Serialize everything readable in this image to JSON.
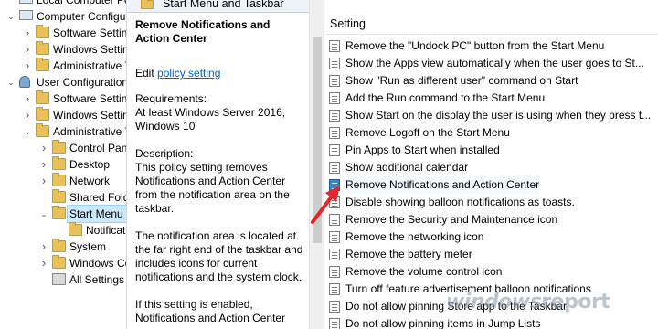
{
  "tree": {
    "items": [
      {
        "label": "Local Computer Policy",
        "expand": "",
        "icon": "computer-icon"
      },
      {
        "label": "Computer Configura",
        "expand": "open",
        "icon": "computer-icon"
      },
      {
        "label": "Software Settings",
        "expand": "closed",
        "icon": "folder-icon"
      },
      {
        "label": "Windows Setting",
        "expand": "closed",
        "icon": "folder-icon"
      },
      {
        "label": "Administrative Te",
        "expand": "closed",
        "icon": "folder-icon"
      },
      {
        "label": "User Configuration",
        "expand": "open",
        "icon": "user-icon"
      },
      {
        "label": "Software Settings",
        "expand": "closed",
        "icon": "folder-icon"
      },
      {
        "label": "Windows Setting",
        "expand": "closed",
        "icon": "folder-icon"
      },
      {
        "label": "Administrative Te",
        "expand": "open",
        "icon": "folder-icon"
      },
      {
        "label": "Control Panel",
        "expand": "closed",
        "icon": "folder-icon"
      },
      {
        "label": "Desktop",
        "expand": "closed",
        "icon": "folder-icon"
      },
      {
        "label": "Network",
        "expand": "closed",
        "icon": "folder-icon"
      },
      {
        "label": "Shared Folder",
        "expand": "",
        "icon": "folder-icon"
      },
      {
        "label": "Start Menu ar",
        "expand": "open",
        "icon": "folder-icon"
      },
      {
        "label": "Notificatio",
        "expand": "",
        "icon": "folder-icon"
      },
      {
        "label": "System",
        "expand": "closed",
        "icon": "folder-icon"
      },
      {
        "label": "Windows Cor",
        "expand": "closed",
        "icon": "folder-icon"
      },
      {
        "label": "All Settings",
        "expand": "",
        "icon": "settings-icon"
      }
    ]
  },
  "description": {
    "header": "Start Menu and Taskbar",
    "title": "Remove Notifications and Action Center",
    "edit_prefix": "Edit ",
    "edit_link": "policy setting",
    "requirements_label": "Requirements:",
    "requirements_text": "At least Windows Server 2016, Windows 10",
    "description_label": "Description:",
    "description_text": "This policy setting removes Notifications and Action Center from the notification area on the taskbar.",
    "paragraph_2": "The notification area is located at the far right end of the taskbar and includes icons for current notifications and the system clock.",
    "paragraph_3": "If this setting is enabled, Notifications and Action Center"
  },
  "settings": {
    "column_header": "Setting",
    "items": [
      "Remove the \"Undock PC\" button from the Start Menu",
      "Show the Apps view automatically when the user goes to St...",
      "Show \"Run as different user\" command on Start",
      "Add the Run command to the Start Menu",
      "Show Start on the display the user is using when they press t...",
      "Remove Logoff on the Start Menu",
      "Pin Apps to Start when installed",
      "Show additional calendar",
      "Remove Notifications and Action Center",
      "Disable showing balloon notifications as toasts.",
      "Remove the Security and Maintenance icon",
      "Remove the networking icon",
      "Remove the battery meter",
      "Remove the volume control icon",
      "Turn off feature advertisement balloon notifications",
      "Do not allow pinning Store app to the Taskbar",
      "Do not allow pinning items in Jump Lists"
    ],
    "selected_index": 8
  },
  "watermark": {
    "first": "windows",
    "second": "report"
  },
  "colors": {
    "arrow": "#e2262a",
    "selection": "#cce8ff",
    "link": "#0066cc",
    "folder": "#e8c15a"
  }
}
